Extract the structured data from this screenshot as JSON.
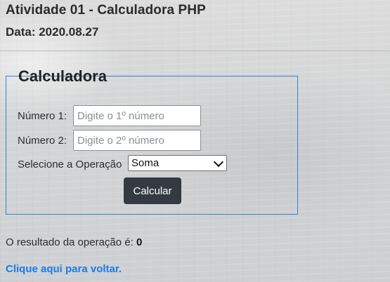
{
  "header": {
    "title": "Atividade 01 - Calculadora PHP",
    "date_label": "Data: 2020.08.27"
  },
  "calculator": {
    "legend": "Calculadora",
    "number1": {
      "label": "Número 1:",
      "value": "",
      "placeholder": "Digite o 1º número"
    },
    "number2": {
      "label": "Número 2:",
      "value": "",
      "placeholder": "Digite o 2º número"
    },
    "operation": {
      "label": "Selecione a Operação",
      "selected": "Soma"
    },
    "submit_label": "Calcular"
  },
  "result": {
    "prefix": "O resultado da operação é:",
    "value": "0"
  },
  "back_link": {
    "label": "Clique aqui para voltar."
  },
  "colors": {
    "border_accent": "#3d7fd6",
    "button_bg": "#343a40",
    "link": "#1a7be8"
  }
}
